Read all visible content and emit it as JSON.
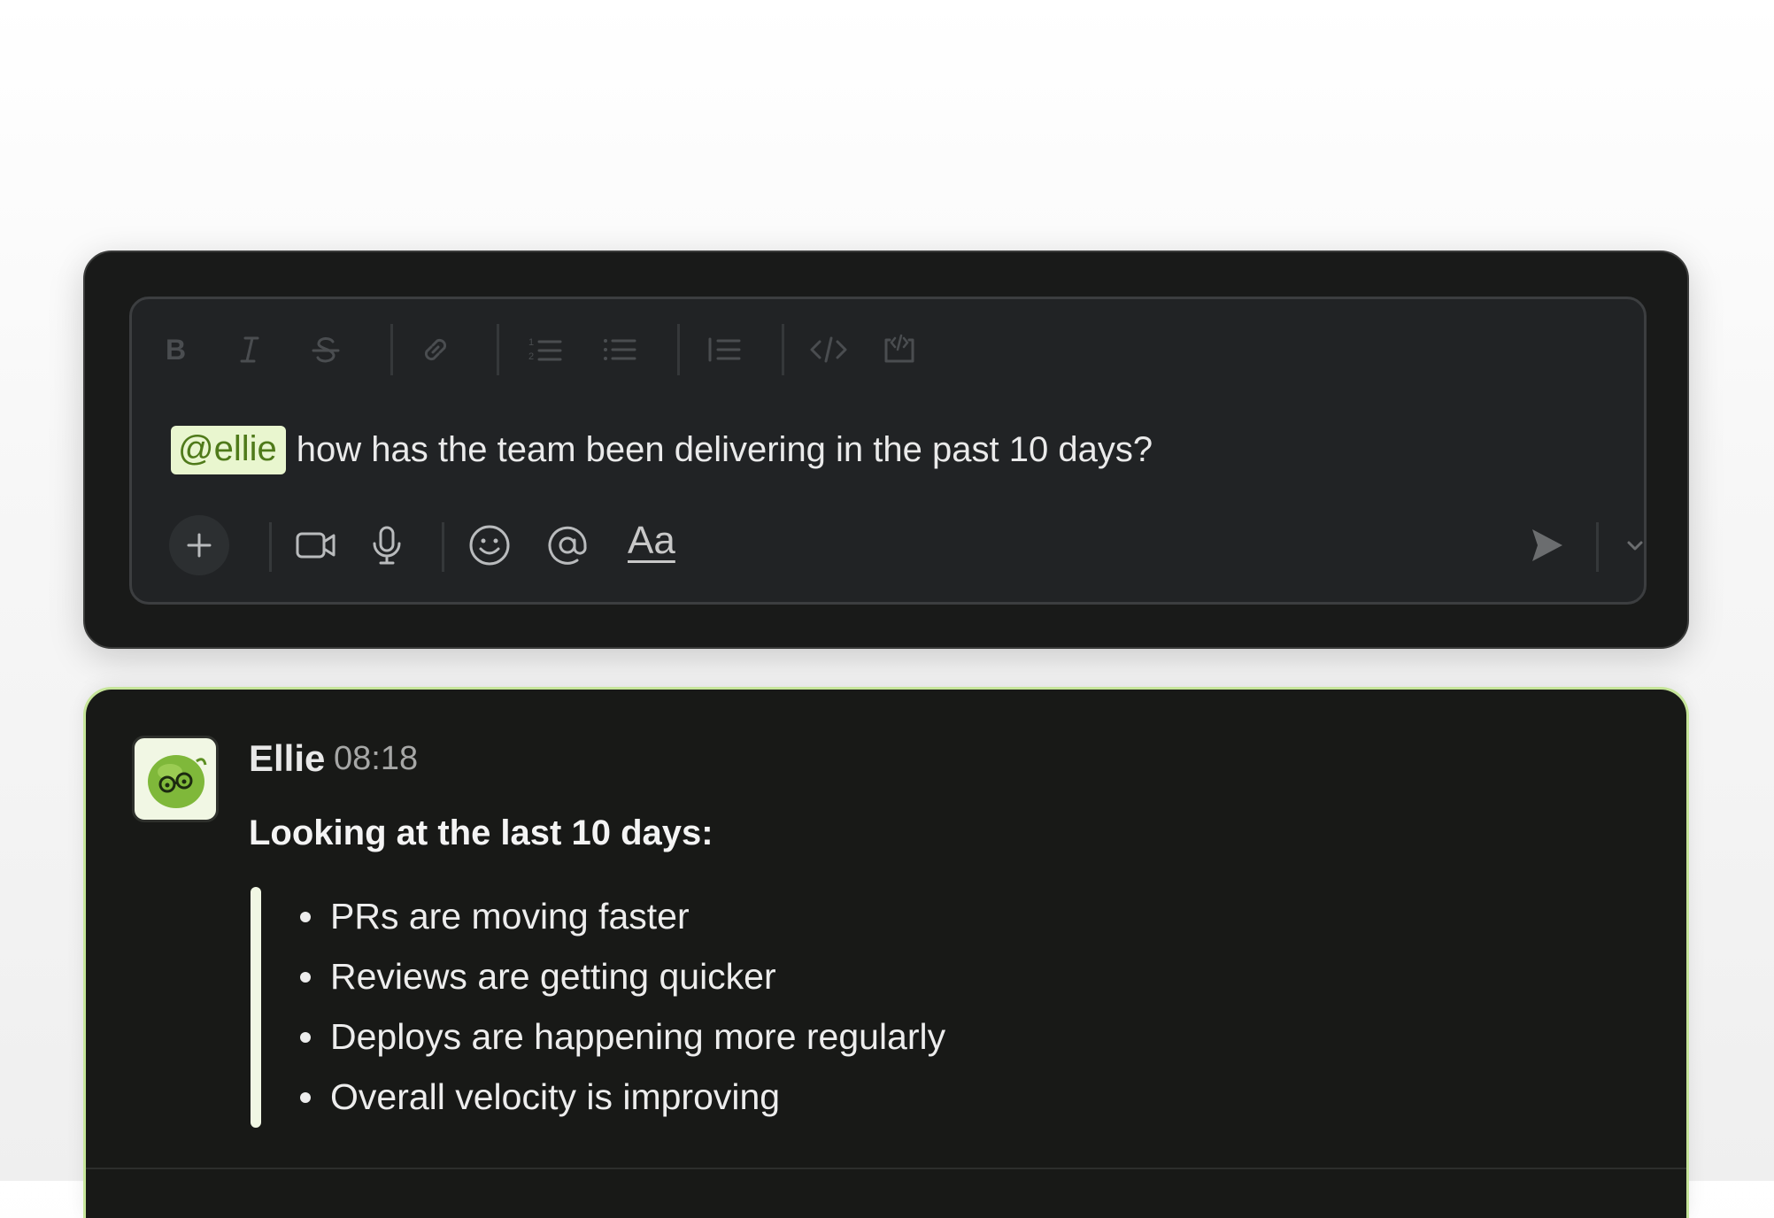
{
  "composer": {
    "toolbar": {
      "icons": [
        "bold-icon",
        "italic-icon",
        "strikethrough-icon",
        "link-icon",
        "ordered-list-icon",
        "bulleted-list-icon",
        "blockquote-icon",
        "code-icon",
        "code-block-icon"
      ]
    },
    "mention": "@ellie",
    "message": "how has the team been delivering in the past 10 days?",
    "actions": {
      "format_label": "Aa",
      "icons": [
        "plus-icon",
        "video-icon",
        "microphone-icon",
        "emoji-icon",
        "at-icon",
        "send-icon",
        "chevron-down-icon"
      ]
    }
  },
  "response": {
    "sender": "Ellie",
    "time": "08:18",
    "intro": "Looking at the last 10 days:",
    "bullets": [
      "PRs are moving faster",
      "Reviews are getting quicker",
      "Deploys are happening more regularly",
      "Overall velocity is improving"
    ]
  },
  "colors": {
    "mention_bg": "#e9f6cf",
    "mention_text": "#4f7a1a",
    "accent_border": "#c6e59a",
    "card_bg": "#191a19",
    "composer_bg": "#212325"
  }
}
